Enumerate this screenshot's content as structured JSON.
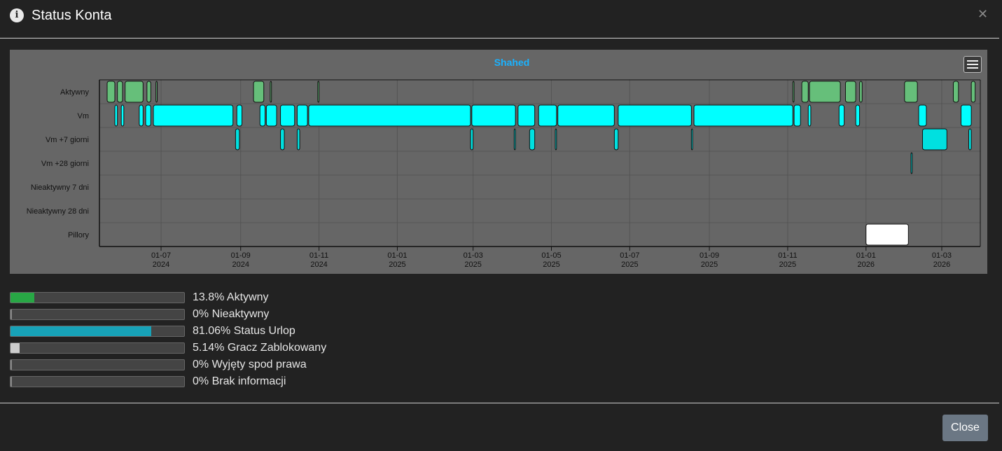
{
  "header": {
    "title": "Status Konta",
    "info_icon": "info-icon",
    "close_symbol": "✕"
  },
  "chart_data": {
    "type": "timeline",
    "title": "Shahed",
    "categories": [
      "Aktywny",
      "Vm",
      "Vm +7 giorni",
      "Vm +28 giorni",
      "Nieaktywny 7 dni",
      "Nieaktywny 28 dni",
      "Pillory"
    ],
    "x_ticks": [
      {
        "date": "2024-07-01",
        "label": "01-07",
        "year": "2024"
      },
      {
        "date": "2024-09-01",
        "label": "01-09",
        "year": "2024"
      },
      {
        "date": "2024-11-01",
        "label": "01-11",
        "year": "2024"
      },
      {
        "date": "2025-01-01",
        "label": "01-01",
        "year": "2025"
      },
      {
        "date": "2025-03-01",
        "label": "01-03",
        "year": "2025"
      },
      {
        "date": "2025-05-01",
        "label": "01-05",
        "year": "2025"
      },
      {
        "date": "2025-07-01",
        "label": "01-07",
        "year": "2025"
      },
      {
        "date": "2025-09-01",
        "label": "01-09",
        "year": "2025"
      },
      {
        "date": "2025-11-01",
        "label": "01-11",
        "year": "2025"
      },
      {
        "date": "2026-01-01",
        "label": "01-01",
        "year": "2026"
      },
      {
        "date": "2026-03-01",
        "label": "01-03",
        "year": "2026"
      }
    ],
    "xlim": [
      "2024-05-14",
      "2026-03-31"
    ],
    "colors": {
      "Aktywny": "#66bf7a",
      "Vm": "#00ffff",
      "Vm +7 giorni": "#00e0e0",
      "Vm +28 giorni": "#00e0e0",
      "Pillory": "#ffffff"
    },
    "segments": [
      {
        "row": 0,
        "start": "2024-05-20",
        "end": "2024-05-26"
      },
      {
        "row": 0,
        "start": "2024-05-28",
        "end": "2024-06-01"
      },
      {
        "row": 0,
        "start": "2024-06-03",
        "end": "2024-06-17"
      },
      {
        "row": 0,
        "start": "2024-06-20",
        "end": "2024-06-23"
      },
      {
        "row": 0,
        "start": "2024-06-27",
        "end": "2024-06-28"
      },
      {
        "row": 0,
        "start": "2024-09-11",
        "end": "2024-09-19"
      },
      {
        "row": 0,
        "start": "2024-09-24",
        "end": "2024-09-25"
      },
      {
        "row": 0,
        "start": "2024-10-31",
        "end": "2024-11-01"
      },
      {
        "row": 0,
        "start": "2025-11-05",
        "end": "2025-11-06"
      },
      {
        "row": 0,
        "start": "2025-11-12",
        "end": "2025-11-17"
      },
      {
        "row": 0,
        "start": "2025-11-18",
        "end": "2025-12-12"
      },
      {
        "row": 0,
        "start": "2025-12-16",
        "end": "2025-12-24"
      },
      {
        "row": 0,
        "start": "2025-12-27",
        "end": "2025-12-29"
      },
      {
        "row": 0,
        "start": "2026-01-31",
        "end": "2026-02-10"
      },
      {
        "row": 0,
        "start": "2026-03-10",
        "end": "2026-03-14"
      },
      {
        "row": 0,
        "start": "2026-03-24",
        "end": "2026-03-27"
      },
      {
        "row": 1,
        "start": "2024-05-26",
        "end": "2024-05-28"
      },
      {
        "row": 1,
        "start": "2024-05-31",
        "end": "2024-06-02"
      },
      {
        "row": 1,
        "start": "2024-06-14",
        "end": "2024-06-17"
      },
      {
        "row": 1,
        "start": "2024-06-19",
        "end": "2024-06-23"
      },
      {
        "row": 1,
        "start": "2024-06-25",
        "end": "2024-08-26"
      },
      {
        "row": 1,
        "start": "2024-08-29",
        "end": "2024-09-02"
      },
      {
        "row": 1,
        "start": "2024-09-16",
        "end": "2024-09-20"
      },
      {
        "row": 1,
        "start": "2024-09-21",
        "end": "2024-09-29"
      },
      {
        "row": 1,
        "start": "2024-10-02",
        "end": "2024-10-13"
      },
      {
        "row": 1,
        "start": "2024-10-15",
        "end": "2024-10-23"
      },
      {
        "row": 1,
        "start": "2024-10-24",
        "end": "2025-02-27"
      },
      {
        "row": 1,
        "start": "2025-02-28",
        "end": "2025-04-03"
      },
      {
        "row": 1,
        "start": "2025-04-05",
        "end": "2025-04-18"
      },
      {
        "row": 1,
        "start": "2025-04-21",
        "end": "2025-05-05"
      },
      {
        "row": 1,
        "start": "2025-05-06",
        "end": "2025-06-19"
      },
      {
        "row": 1,
        "start": "2025-06-22",
        "end": "2025-08-18"
      },
      {
        "row": 1,
        "start": "2025-08-20",
        "end": "2025-11-05"
      },
      {
        "row": 1,
        "start": "2025-11-06",
        "end": "2025-11-11"
      },
      {
        "row": 1,
        "start": "2025-11-17",
        "end": "2025-11-19"
      },
      {
        "row": 1,
        "start": "2025-12-11",
        "end": "2025-12-15"
      },
      {
        "row": 1,
        "start": "2025-12-24",
        "end": "2025-12-27"
      },
      {
        "row": 1,
        "start": "2026-02-11",
        "end": "2026-02-17"
      },
      {
        "row": 1,
        "start": "2026-03-16",
        "end": "2026-03-24"
      },
      {
        "row": 2,
        "start": "2024-08-28",
        "end": "2024-08-31"
      },
      {
        "row": 2,
        "start": "2024-10-02",
        "end": "2024-10-05"
      },
      {
        "row": 2,
        "start": "2024-10-15",
        "end": "2024-10-17"
      },
      {
        "row": 2,
        "start": "2025-02-27",
        "end": "2025-03-01"
      },
      {
        "row": 2,
        "start": "2025-04-02",
        "end": "2025-04-03"
      },
      {
        "row": 2,
        "start": "2025-04-14",
        "end": "2025-04-18"
      },
      {
        "row": 2,
        "start": "2025-05-04",
        "end": "2025-05-05"
      },
      {
        "row": 2,
        "start": "2025-06-19",
        "end": "2025-06-22"
      },
      {
        "row": 2,
        "start": "2025-08-18",
        "end": "2025-08-19"
      },
      {
        "row": 2,
        "start": "2026-02-14",
        "end": "2026-03-05"
      },
      {
        "row": 2,
        "start": "2026-03-22",
        "end": "2026-03-24"
      },
      {
        "row": 3,
        "start": "2026-02-05",
        "end": "2026-02-06"
      },
      {
        "row": 6,
        "start": "2026-01-01",
        "end": "2026-02-03"
      }
    ]
  },
  "stats": [
    {
      "label": "13.8% Aktywny",
      "value": 13.8,
      "color": "#28a745"
    },
    {
      "label": "0% Nieaktywny",
      "value": 0,
      "color": "#888888"
    },
    {
      "label": "81.06% Status Urlop",
      "value": 81.06,
      "color": "#17a2b8"
    },
    {
      "label": "5.14% Gracz Zablokowany",
      "value": 5.14,
      "color": "#cccccc"
    },
    {
      "label": "0% Wyjęty spod prawa",
      "value": 0,
      "color": "#888888"
    },
    {
      "label": "0% Brak informacji",
      "value": 0,
      "color": "#888888"
    }
  ],
  "footer": {
    "close_label": "Close"
  }
}
